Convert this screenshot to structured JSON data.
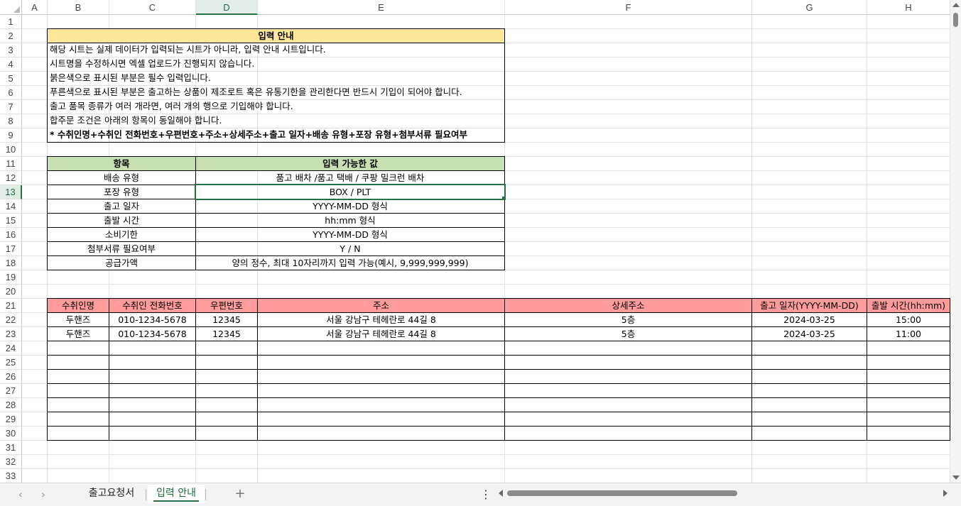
{
  "columns": [
    "A",
    "B",
    "C",
    "D",
    "E",
    "F",
    "G",
    "H"
  ],
  "rows": [
    "1",
    "2",
    "3",
    "4",
    "5",
    "6",
    "7",
    "8",
    "9",
    "10",
    "11",
    "12",
    "13",
    "14",
    "15",
    "16",
    "17",
    "18",
    "19",
    "20",
    "21",
    "22",
    "23",
    "24",
    "25",
    "26",
    "27",
    "28",
    "29",
    "30",
    "31",
    "32",
    "33"
  ],
  "selected_column": "D",
  "selected_row": "13",
  "guide": {
    "title": "입력 안내",
    "lines": [
      "해당 시트는 실제 데이터가 입력되는 시트가 아니라, 입력 안내 시트입니다.",
      "시트명을 수정하시면 엑셀 업로드가 진행되지 않습니다.",
      "붉은색으로 표시된 부분은 필수 입력입니다.",
      "푸른색으로 표시된 부분은 출고하는 상품이 제조로트 혹은 유통기한을 관리한다면 반드시 기입이 되어야 합니다.",
      "출고 품목 종류가 여러 개라면, 여러 개의 행으로 기입해야 합니다.",
      "합주문 조건은 아래의 항목이 동일해야 합니다.",
      "* 수취인명+수취인 전화번호+우편번호+주소+상세주소+출고 일자+배송 유형+포장 유형+첨부서류 필요여부"
    ]
  },
  "values_table": {
    "header_item": "항목",
    "header_values": "입력 가능한 값",
    "rows": [
      {
        "item": "배송 유형",
        "value": "품고 배차 /품고 택배 / 쿠팡 밀크런 배차"
      },
      {
        "item": "포장 유형",
        "value": "BOX / PLT"
      },
      {
        "item": "출고 일자",
        "value": "YYYY-MM-DD  형식"
      },
      {
        "item": "출발 시간",
        "value": "hh:mm 형식"
      },
      {
        "item": "소비기한",
        "value": "YYYY-MM-DD 형식"
      },
      {
        "item": "첨부서류 필요여부",
        "value": "Y / N"
      },
      {
        "item": "공급가액",
        "value": "양의 정수, 최대 10자리까지 입력 가능(예시, 9,999,999,999)"
      }
    ]
  },
  "sample_table": {
    "headers": [
      "수취인명",
      "수취인 전화번호",
      "우편번호",
      "주소",
      "상세주소",
      "출고 일자(YYYY-MM-DD)",
      "출발 시간(hh:mm)"
    ],
    "rows": [
      [
        "두핸즈",
        "010-1234-5678",
        "12345",
        "서울 강남구 테헤란로 44길 8",
        "5층",
        "2024-03-25",
        "15:00"
      ],
      [
        "두핸즈",
        "010-1234-5678",
        "12345",
        "서울 강남구 테헤란로 44길 8",
        "5층",
        "2024-03-25",
        "11:00"
      ],
      [
        "",
        "",
        "",
        "",
        "",
        "",
        ""
      ],
      [
        "",
        "",
        "",
        "",
        "",
        "",
        ""
      ],
      [
        "",
        "",
        "",
        "",
        "",
        "",
        ""
      ],
      [
        "",
        "",
        "",
        "",
        "",
        "",
        ""
      ],
      [
        "",
        "",
        "",
        "",
        "",
        "",
        ""
      ],
      [
        "",
        "",
        "",
        "",
        "",
        "",
        ""
      ],
      [
        "",
        "",
        "",
        "",
        "",
        "",
        ""
      ]
    ]
  },
  "sheet_tabs": [
    {
      "label": "출고요청서",
      "active": false
    },
    {
      "label": "입력 안내",
      "active": true
    }
  ],
  "nav": {
    "prev": "‹",
    "next": "›",
    "add": "+",
    "more": "⋮"
  },
  "colors": {
    "header_yellow": "#ffe699",
    "header_green": "#c6e0b4",
    "header_red": "#ff9b9b",
    "accent": "#217346"
  }
}
